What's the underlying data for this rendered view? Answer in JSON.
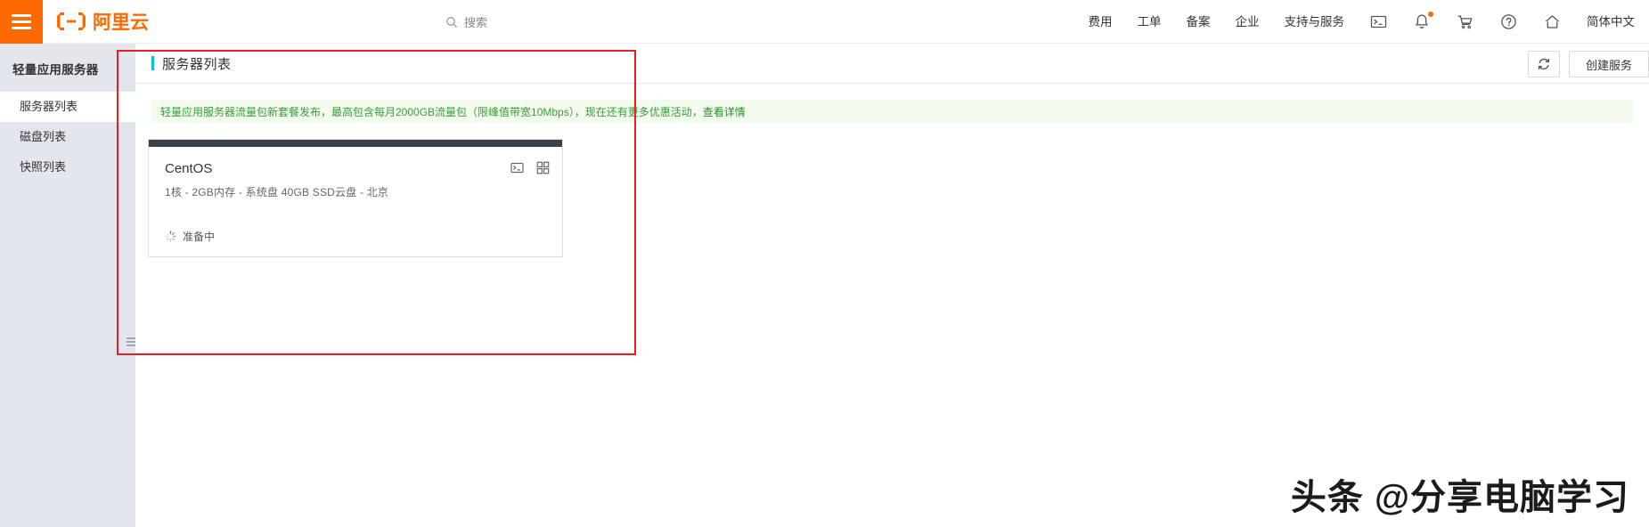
{
  "topnav": {
    "menu_icon": "hamburger-menu-icon",
    "logo_text": "阿里云",
    "search_placeholder": "搜索",
    "search_icon": "search-icon",
    "items": [
      {
        "label": "费用"
      },
      {
        "label": "工单"
      },
      {
        "label": "备案"
      },
      {
        "label": "企业"
      },
      {
        "label": "支持与服务"
      }
    ],
    "icons": [
      {
        "name": "terminal-icon"
      },
      {
        "name": "bell-icon",
        "has_badge": true
      },
      {
        "name": "cart-icon"
      },
      {
        "name": "help-icon"
      },
      {
        "name": "home-icon"
      }
    ],
    "language": "简体中文"
  },
  "sidebar": {
    "title": "轻量应用服务器",
    "items": [
      {
        "label": "服务器列表",
        "active": true
      },
      {
        "label": "磁盘列表",
        "active": false
      },
      {
        "label": "快照列表",
        "active": false
      }
    ],
    "collapse_icon": "collapse-sidebar-icon"
  },
  "main": {
    "page_title": "服务器列表",
    "refresh_icon": "refresh-icon",
    "create_button": "创建服务",
    "notice": {
      "text": "轻量应用服务器流量包新套餐发布，最高包含每月2000GB流量包（限峰值带宽10Mbps），现在还有更多优惠活动，",
      "link": "查看详情"
    },
    "server_card": {
      "title": "CentOS",
      "spec": "1核 - 2GB内存 - 系统盘 40GB SSD云盘 - 北京",
      "status": "准备中",
      "status_icon": "loading-spinner-icon",
      "icons": [
        {
          "name": "terminal-console-icon"
        },
        {
          "name": "grid-apps-icon"
        }
      ]
    }
  },
  "annotation": {
    "name": "red-highlight-box",
    "color": "#ee1c22"
  },
  "watermark": {
    "text": "头条 @分享电脑学习"
  },
  "colors": {
    "brand_orange": "#ff6a00",
    "accent_cyan": "#00c1de",
    "notice_green": "#3a9c3a",
    "notice_bg": "#f3fbef",
    "sidebar_bg": "#e3e7ed",
    "card_topbar": "#394149"
  }
}
